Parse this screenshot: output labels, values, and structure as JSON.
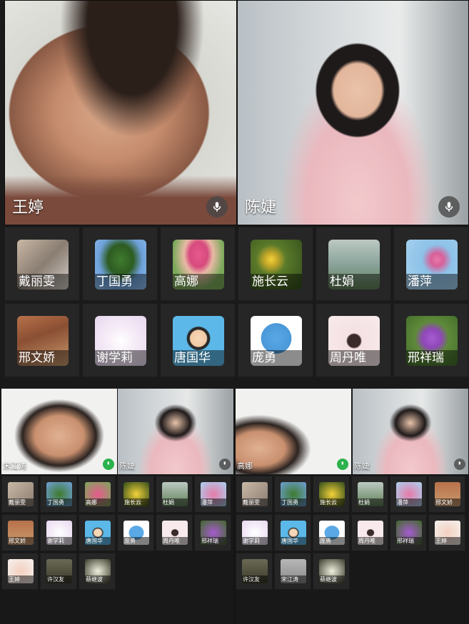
{
  "main_videos": [
    {
      "name": "王婷",
      "mic": "mic-icon"
    },
    {
      "name": "陈婕",
      "mic": "mic-icon"
    }
  ],
  "participants": [
    {
      "name": "戴丽雯"
    },
    {
      "name": "丁国勇"
    },
    {
      "name": "高娜"
    },
    {
      "name": "施长云"
    },
    {
      "name": "杜娟"
    },
    {
      "name": "潘萍"
    },
    {
      "name": "邢文娇"
    },
    {
      "name": "谢学莉"
    },
    {
      "name": "唐国华"
    },
    {
      "name": "庞勇"
    },
    {
      "name": "周丹唯"
    },
    {
      "name": "邢祥瑞"
    }
  ],
  "left_panel": {
    "videos": [
      {
        "name": "宋江涛",
        "mic_active": true
      },
      {
        "name": "陈婕",
        "mic_active": false
      }
    ],
    "row1": [
      "戴丽雯",
      "丁国勇",
      "高娜",
      "施长云",
      "杜娟",
      "潘萍"
    ],
    "row2": [
      "邢文娇",
      "谢学莉",
      "唐国华",
      "庞勇",
      "周丹唯",
      "邢祥瑞"
    ],
    "row3": [
      "王婷",
      "许汉友",
      "蔡继波"
    ]
  },
  "right_panel": {
    "videos": [
      {
        "name": "高娜",
        "mic_active": true
      },
      {
        "name": "陈婕",
        "mic_active": false
      }
    ],
    "row1": [
      "戴丽雯",
      "丁国勇",
      "施长云",
      "杜娟",
      "潘萍",
      "邢文娇"
    ],
    "row2": [
      "谢学莉",
      "唐国华",
      "庞勇",
      "周丹唯",
      "邢祥瑞",
      "王婷"
    ],
    "row3": [
      "许汉友",
      "宋江涛",
      "蔡继波"
    ]
  },
  "colors": {
    "background": "#141414",
    "tile": "#262626",
    "mic_active": "#2bb24c"
  }
}
